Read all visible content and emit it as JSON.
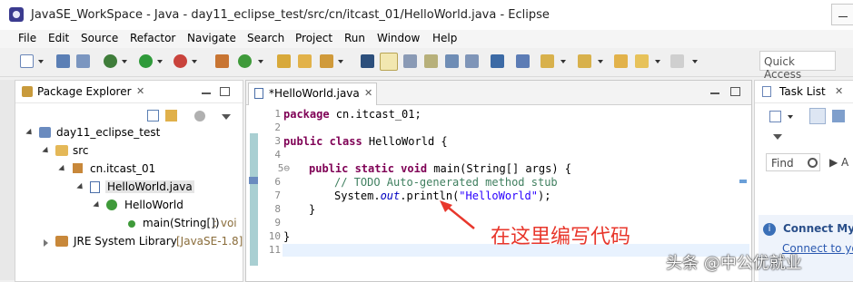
{
  "window": {
    "title": "JavaSE_WorkSpace - Java - day11_eclipse_test/src/cn/itcast_01/HelloWorld.java - Eclipse"
  },
  "menu": [
    "File",
    "Edit",
    "Source",
    "Refactor",
    "Navigate",
    "Search",
    "Project",
    "Run",
    "Window",
    "Help"
  ],
  "toolbar": {
    "quick_access_placeholder": "Quick Access"
  },
  "package_explorer": {
    "title": "Package Explorer",
    "close_glyph": "✕",
    "tree": {
      "project": "day11_eclipse_test",
      "src": "src",
      "package": "cn.itcast_01",
      "file": "HelloWorld.java",
      "class": "HelloWorld",
      "method": "main(String[])",
      "method_suffix": " : voi",
      "jre": "JRE System Library",
      "jre_suffix": "[JavaSE-1.8]"
    }
  },
  "editor": {
    "tab_title": "*HelloWorld.java",
    "close_glyph": "✕",
    "line_numbers": [
      "1",
      "2",
      "3",
      "4",
      "5⊖",
      "6",
      "7",
      "8",
      "9",
      "10",
      "11"
    ],
    "code": {
      "l1_kw": "package",
      "l1_rest": " cn.itcast_01;",
      "l3_kw": "public class",
      "l3_rest": " HelloWorld {",
      "l5_kw": "public static void",
      "l5_rest": " main(String[] args) {",
      "l6_comment": "// TODO Auto-generated method stub",
      "l7_a": "System.",
      "l7_out": "out",
      "l7_b": ".println(",
      "l7_str": "\"HelloWorld\"",
      "l7_c": ");",
      "l8": "}",
      "l10": "}"
    }
  },
  "task_list": {
    "title": "Task List",
    "find_placeholder": "Find",
    "connect_title": "Connect My",
    "connect_link": "Connect to yo"
  },
  "annotation": {
    "text": "在这里编写代码",
    "color": "#e8372c"
  },
  "watermark": {
    "text": "头条 @中公优就业"
  }
}
